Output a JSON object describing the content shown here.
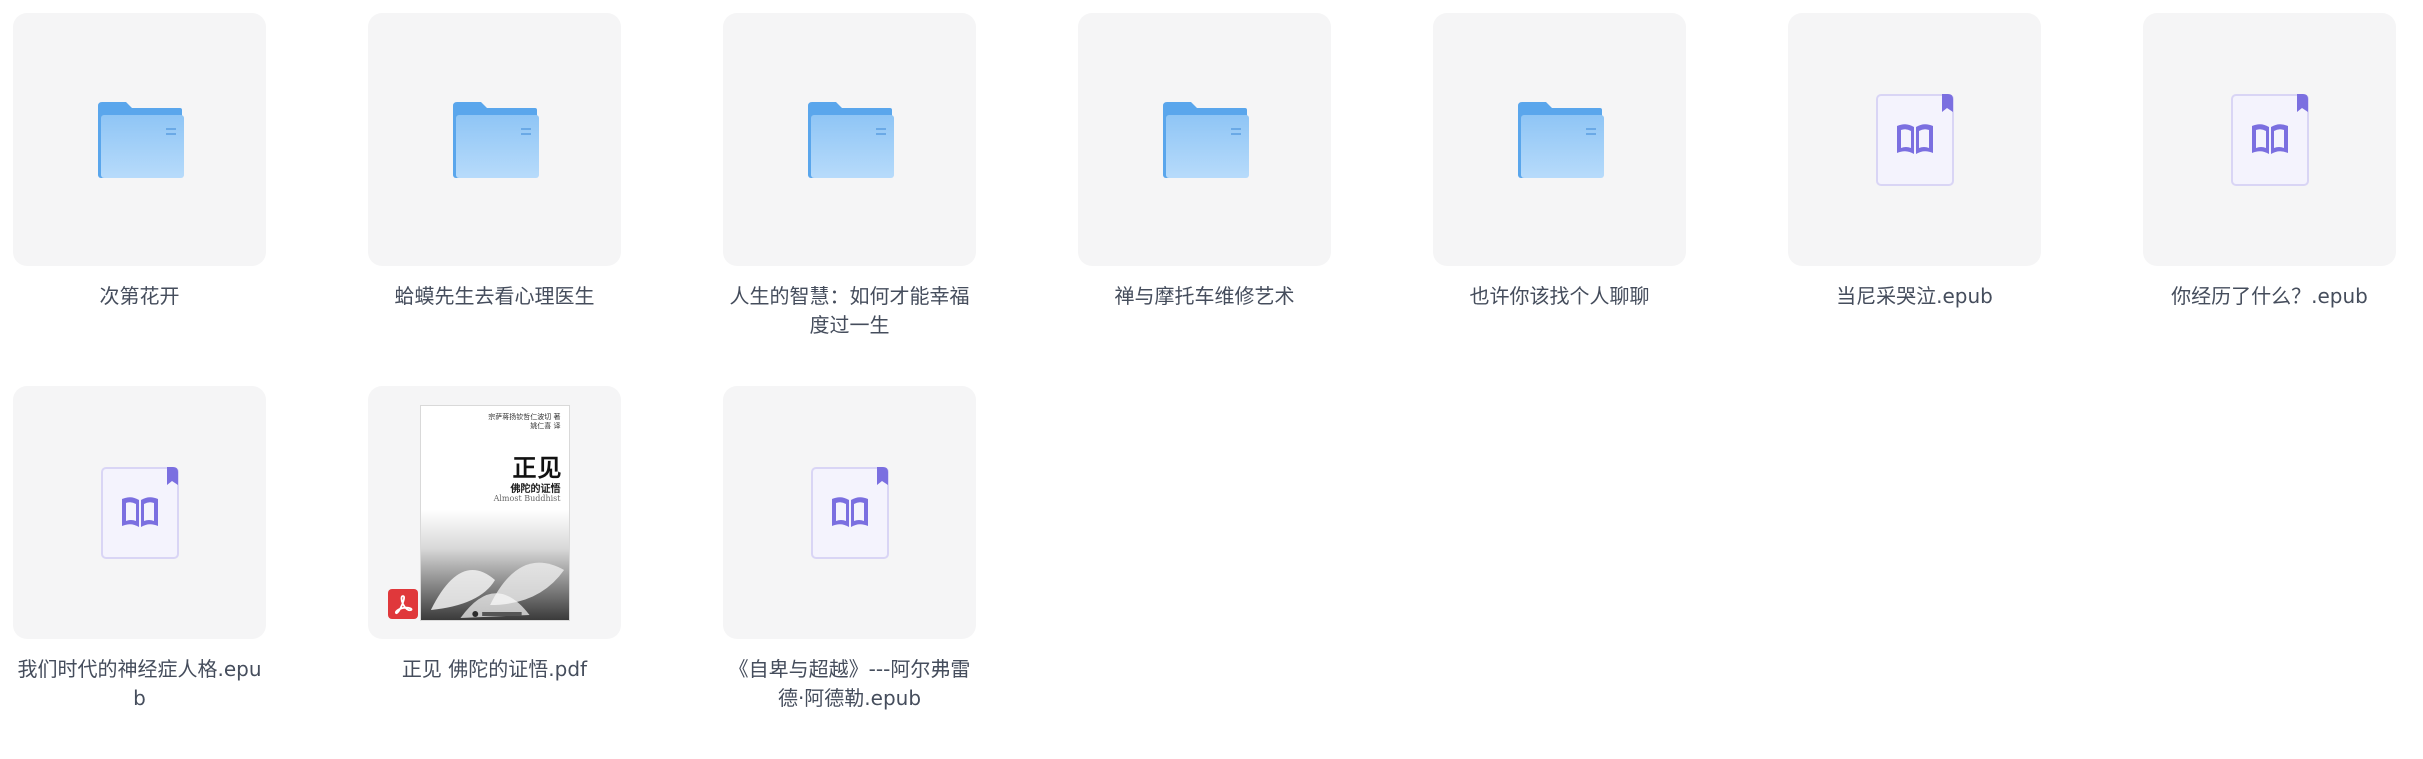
{
  "items": [
    {
      "type": "folder",
      "name": "次第花开"
    },
    {
      "type": "folder",
      "name": "蛤蟆先生去看心理医生"
    },
    {
      "type": "folder",
      "name": "人生的智慧：如何才能幸福度过一生"
    },
    {
      "type": "folder",
      "name": "禅与摩托车维修艺术"
    },
    {
      "type": "folder",
      "name": "也许你该找个人聊聊"
    },
    {
      "type": "epub",
      "name": "当尼采哭泣.epub"
    },
    {
      "type": "epub",
      "name": "你经历了什么？.epub"
    },
    {
      "type": "epub",
      "name": "我们时代的神经症人格.epub"
    },
    {
      "type": "pdf",
      "name": "正见 佛陀的证悟.pdf",
      "cover": {
        "authors_line1": "宗萨蒋扬钦哲仁波切 著",
        "authors_line2": "姚仁喜 译",
        "title": "正见",
        "subtitle": "佛陀的证悟",
        "english": "Almost Buddhist"
      }
    },
    {
      "type": "epub",
      "name": "《自卑与超越》---阿尔弗雷德·阿德勒.epub"
    }
  ],
  "colors": {
    "tile_bg": "#f5f5f6",
    "folder_blue": "#7fbaf2",
    "epub_purple": "#7b6fe0",
    "pdf_red": "#e0383b",
    "label_text": "#454d5c"
  },
  "icons": {
    "folder": "folder-icon",
    "epub": "book-open-icon",
    "pdf": "pdf-icon"
  }
}
